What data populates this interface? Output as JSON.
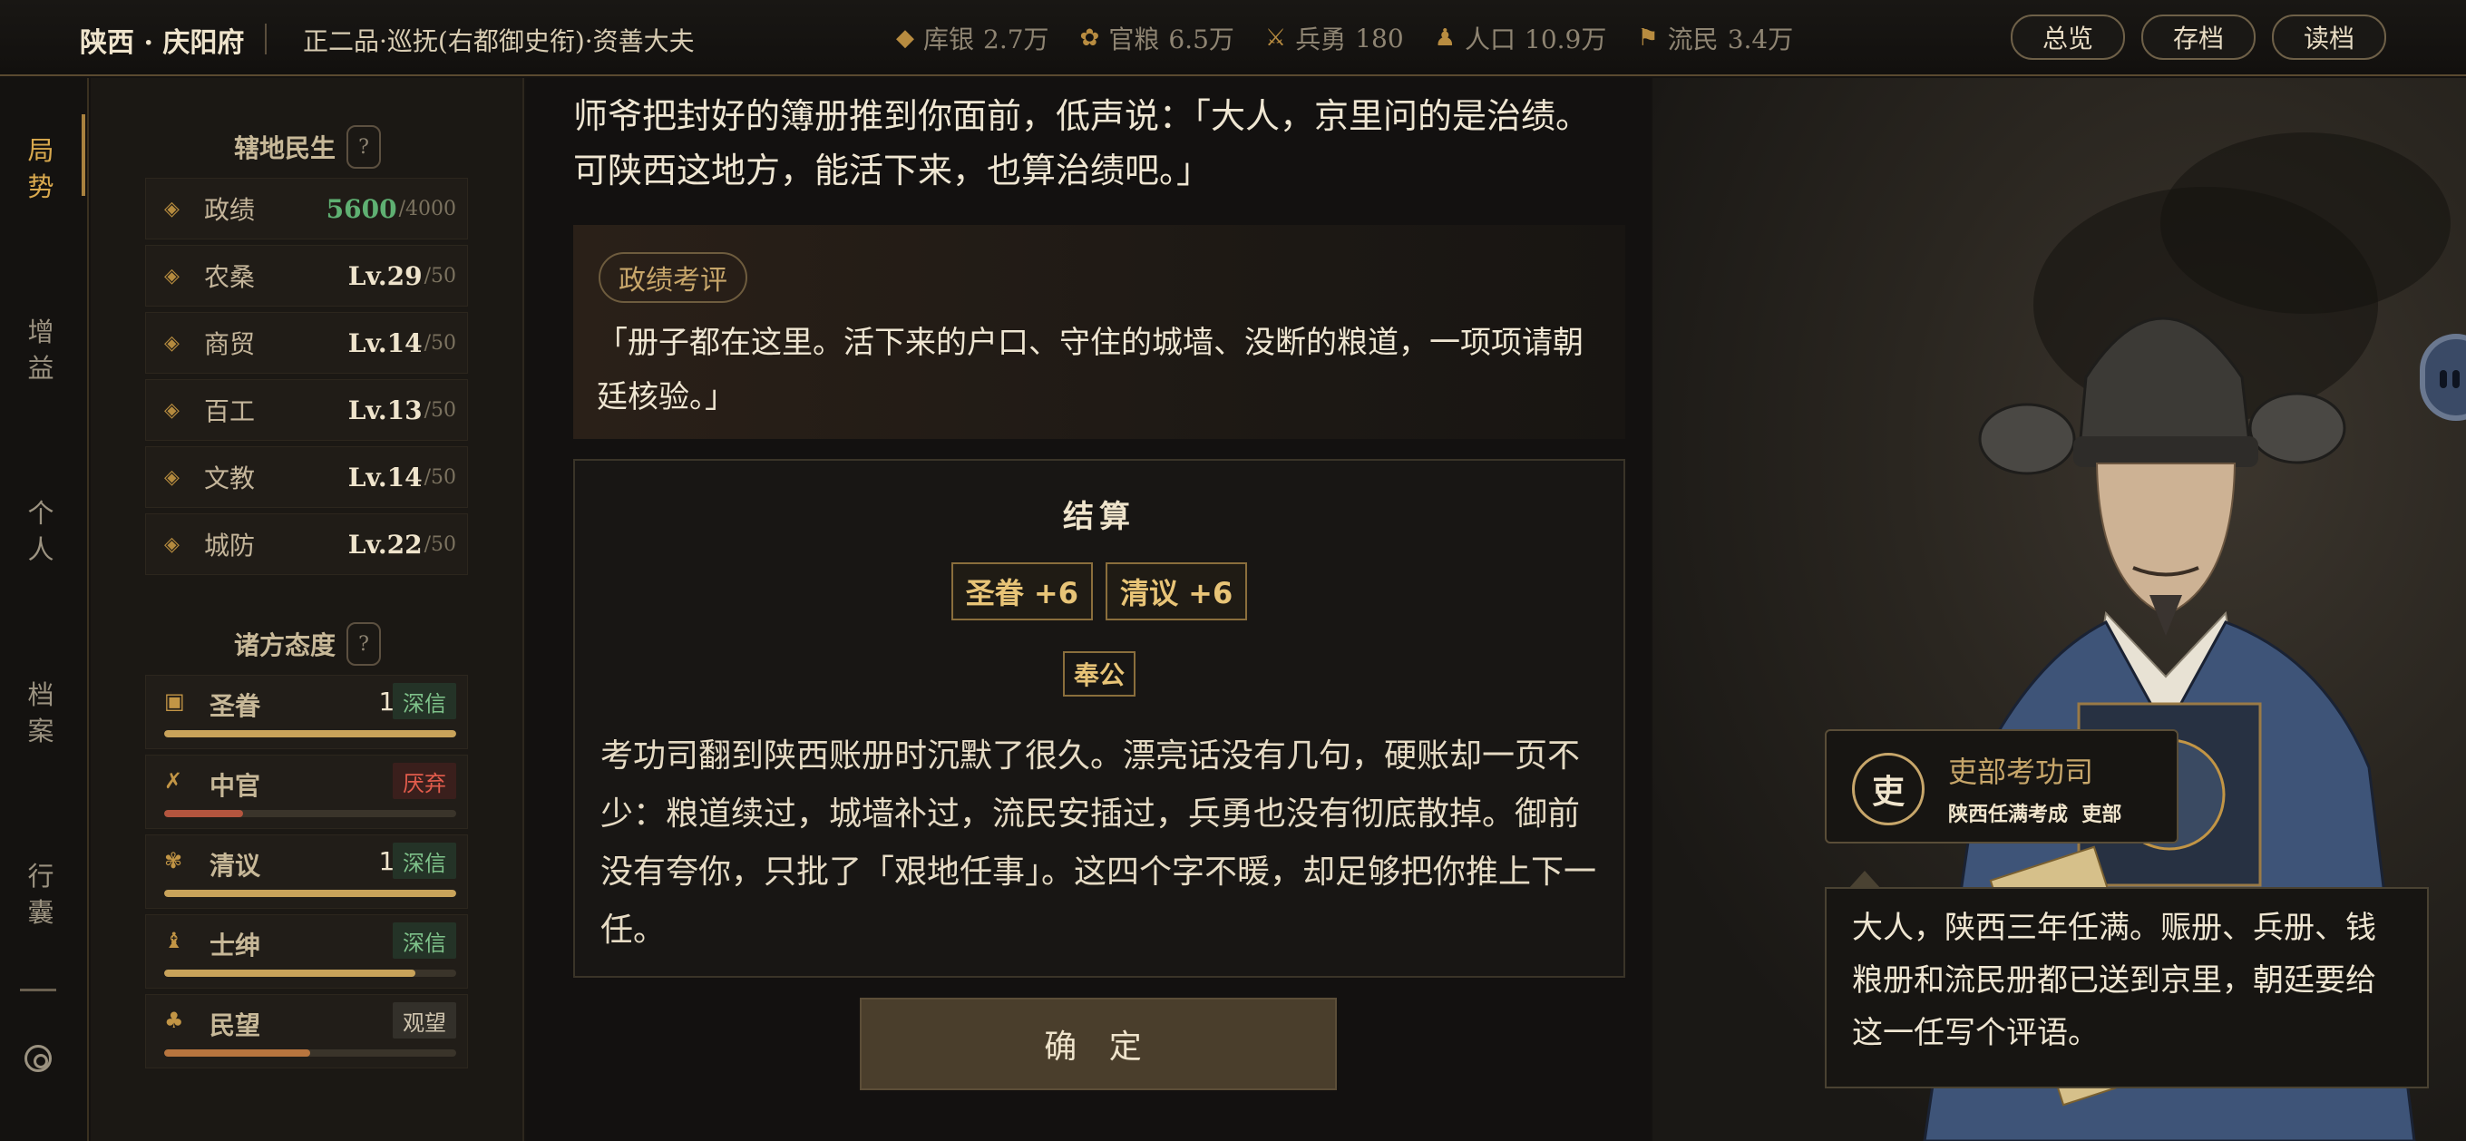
{
  "header": {
    "place": "陕西 · 庆阳府",
    "rank": "正二品·巡抚(右都御史衔)·资善大夫",
    "stats": [
      {
        "icon": "silver-icon",
        "label": "库银",
        "value": "2.7万"
      },
      {
        "icon": "grain-icon",
        "label": "官粮",
        "value": "6.5万"
      },
      {
        "icon": "soldier-icon",
        "label": "兵勇",
        "value": "180"
      },
      {
        "icon": "people-icon",
        "label": "人口",
        "value": "10.9万"
      },
      {
        "icon": "refugee-icon",
        "label": "流民",
        "value": "3.4万"
      }
    ],
    "buttons": {
      "overview": "总览",
      "save": "存档",
      "load": "读档"
    }
  },
  "nav": {
    "items": [
      "局\n势",
      "增\n益",
      "个\n人",
      "档\n案",
      "行\n囊"
    ],
    "active_index": 0
  },
  "region": {
    "title": "辖地民生",
    "help": "?",
    "rows": [
      {
        "icon": "merit-icon",
        "label": "政绩",
        "value": "5600",
        "max": "/4000",
        "highlight": true
      },
      {
        "icon": "farming-icon",
        "label": "农桑",
        "value": "Lv.29",
        "max": "/50"
      },
      {
        "icon": "trade-icon",
        "label": "商贸",
        "value": "Lv.14",
        "max": "/50"
      },
      {
        "icon": "craft-icon",
        "label": "百工",
        "value": "Lv.13",
        "max": "/50"
      },
      {
        "icon": "culture-icon",
        "label": "文教",
        "value": "Lv.14",
        "max": "/50"
      },
      {
        "icon": "defense-icon",
        "label": "城防",
        "value": "Lv.22",
        "max": "/50"
      }
    ]
  },
  "factions": {
    "title": "诸方态度",
    "help": "?",
    "rows": [
      {
        "icon": "emperor-icon",
        "label": "圣眷",
        "value": "100",
        "badge": "深信",
        "badge_type": "trust",
        "level": 1.0,
        "color": "#c9a35a"
      },
      {
        "icon": "eunuch-icon",
        "label": "中官",
        "value": "27",
        "badge": "厌弃",
        "badge_type": "hate",
        "level": 0.27,
        "color": "#b4553e"
      },
      {
        "icon": "literati-icon",
        "label": "清议",
        "value": "100",
        "badge": "深信",
        "badge_type": "trust",
        "level": 1.0,
        "color": "#c9a35a"
      },
      {
        "icon": "gentry-icon",
        "label": "士绅",
        "value": "86",
        "badge": "深信",
        "badge_type": "trust",
        "level": 0.86,
        "color": "#c9a35a"
      },
      {
        "icon": "populace-icon",
        "label": "民望",
        "value": "50",
        "badge": "观望",
        "badge_type": "watch",
        "level": 0.5,
        "color": "#b8753e"
      }
    ]
  },
  "story": {
    "narration": "师爷把封好的簿册推到你面前，低声说：「大人，京里问的是治绩。可陕西这地方，能活下来，也算治绩吧。」",
    "review_label": "政绩考评",
    "review_quote": "「册子都在这里。活下来的户口、守住的城墙、没断的粮道，一项项请朝廷核验。」"
  },
  "settlement": {
    "title": "结算",
    "chips": [
      "圣眷 +6",
      "清议 +6"
    ],
    "tag": "奉公",
    "body": "考功司翻到陕西账册时沉默了很久。漂亮话没有几句，硬账却一页不少：粮道续过，城墙补过，流民安插过，兵勇也没有彻底散掉。御前没有夸你，只批了「艰地任事」。这四个字不暖，却足够把你推上下一任。"
  },
  "confirm_label": "确 定",
  "npc": {
    "seal": "吏",
    "name": "吏部考功司",
    "subtitle": "陕西任满考成",
    "subtitle2": "吏部",
    "speech": "大人，陕西三年任满。赈册、兵册、钱粮册和流民册都已送到京里，朝廷要给这一任写个评语。"
  }
}
